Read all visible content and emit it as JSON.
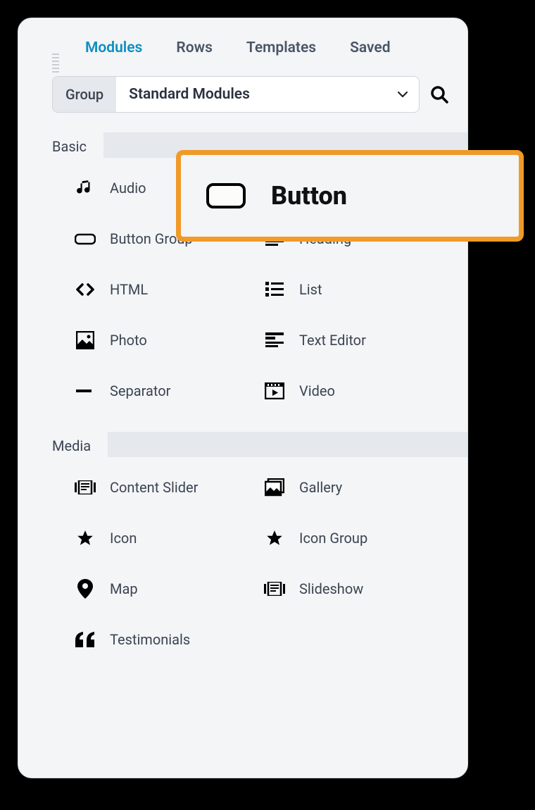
{
  "tabs": {
    "modules": "Modules",
    "rows": "Rows",
    "templates": "Templates",
    "saved": "Saved",
    "active": "modules"
  },
  "group_select": {
    "label": "Group",
    "value": "Standard Modules"
  },
  "sections": [
    {
      "id": "basic",
      "title": "Basic",
      "items": [
        {
          "icon": "audio",
          "label": "Audio"
        },
        {
          "icon": "button",
          "label": "Button",
          "highlighted": true
        },
        {
          "icon": "button-group",
          "label": "Button Group"
        },
        {
          "icon": "heading",
          "label": "Heading"
        },
        {
          "icon": "html",
          "label": "HTML"
        },
        {
          "icon": "list",
          "label": "List"
        },
        {
          "icon": "photo",
          "label": "Photo"
        },
        {
          "icon": "text-editor",
          "label": "Text Editor"
        },
        {
          "icon": "separator",
          "label": "Separator"
        },
        {
          "icon": "video",
          "label": "Video"
        }
      ]
    },
    {
      "id": "media",
      "title": "Media",
      "items": [
        {
          "icon": "content-slider",
          "label": "Content Slider"
        },
        {
          "icon": "gallery",
          "label": "Gallery"
        },
        {
          "icon": "icon",
          "label": "Icon"
        },
        {
          "icon": "icon-group",
          "label": "Icon Group"
        },
        {
          "icon": "map",
          "label": "Map"
        },
        {
          "icon": "slideshow",
          "label": "Slideshow"
        },
        {
          "icon": "testimonials",
          "label": "Testimonials"
        }
      ]
    }
  ],
  "callout": {
    "label": "Button"
  },
  "colors": {
    "accent": "#0d8ec1",
    "highlight_border": "#f09a28"
  }
}
